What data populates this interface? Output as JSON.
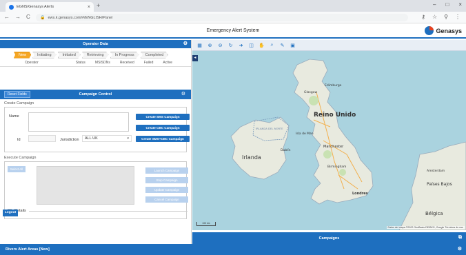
{
  "browser": {
    "tab_title": "EGNS/Genasys Alerts",
    "tab_close": "×",
    "new_tab": "+",
    "win_controls": [
      "–",
      "□",
      "×"
    ],
    "nav": [
      "←",
      "→",
      "C"
    ],
    "url": "ews.k.genasys.com/#/ENGLISH/Panel",
    "lock": "🔒",
    "right_icons": [
      "⚷",
      "☆",
      "⚲",
      "⋮"
    ]
  },
  "app": {
    "title": "Emergency Alert System",
    "brand": "Genasys"
  },
  "operator_data": {
    "title": "Operator Data",
    "steps": [
      "New",
      "Initiating",
      "Initiated",
      "Retrieving",
      "In Progress",
      "Completed"
    ],
    "active_step": 0,
    "columns": [
      "Operator",
      "Status",
      "MSISDNs",
      "Received",
      "Failed",
      "Active"
    ]
  },
  "campaign_control": {
    "reset_label": "Reset Fields",
    "title": "Campaign Control",
    "create_label": "Create Campaign",
    "name_label": "Name",
    "id_label": "Id",
    "jurisdiction_label": "Jurisdiction",
    "jurisdiction_value": "ALL UK",
    "buttons": [
      "Create SMS Campaign",
      "Create CBC Campaign",
      "Create SMS+CBC Campaign"
    ],
    "execute_label": "Execute Campaign",
    "mini_button": "Select All",
    "exec_buttons": [
      "Launch Campaign",
      "Stop Campaign",
      "Update Campaign",
      "Cancel Campaign"
    ],
    "details_label": "Details",
    "logout_label": "Logout"
  },
  "map": {
    "toolbar_icons": [
      "layers-icon",
      "zoom-in-icon",
      "zoom-out-icon",
      "refresh-icon",
      "arrow-icon",
      "grid-icon",
      "hand-icon",
      "search-icon",
      "draw-icon",
      "clear-icon"
    ],
    "labels": {
      "reino_unido": "Reino Unido",
      "irlanda": "Irlanda",
      "isla_man": "Isla de Man",
      "edinburgh": "Edimburgo",
      "glasgow": "Glasgow",
      "dublin": "Dublín",
      "manchester": "Manchester",
      "londres": "Londres",
      "amsterdam": "Amsterdam",
      "paises_bajos": "Países Bajos",
      "belgica": "Bélgica",
      "birmingham": "Birmingham",
      "irlanda_norte": "IRLANDA DEL NORTE"
    },
    "attribution": "Datos del mapa ©2022 GeoBasis-DE/BKG, Google  Términos de uso",
    "scale": "100 km"
  },
  "campaigns": {
    "title": "Campaigns"
  },
  "bottom": {
    "title": "Rivers Alert Areas [New]"
  }
}
